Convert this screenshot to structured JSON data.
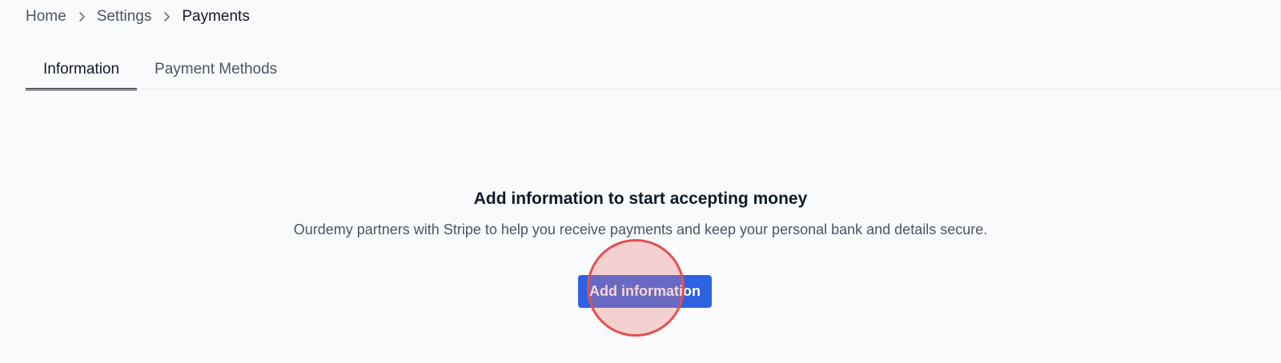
{
  "breadcrumb": {
    "items": [
      {
        "label": "Home"
      },
      {
        "label": "Settings"
      },
      {
        "label": "Payments"
      }
    ],
    "separator_icon": "chevron-right-icon"
  },
  "tabs": [
    {
      "label": "Information",
      "active": true
    },
    {
      "label": "Payment Methods",
      "active": false
    }
  ],
  "empty_state": {
    "title": "Add information to start accepting money",
    "description": "Ourdemy partners with Stripe to help you receive payments and keep your personal bank and details secure.",
    "button_label": "Add information"
  },
  "colors": {
    "primary_button": "#2d62e3",
    "active_tab_indicator": "#111827",
    "click_marker": "#e35050",
    "background": "#f9fafb"
  }
}
